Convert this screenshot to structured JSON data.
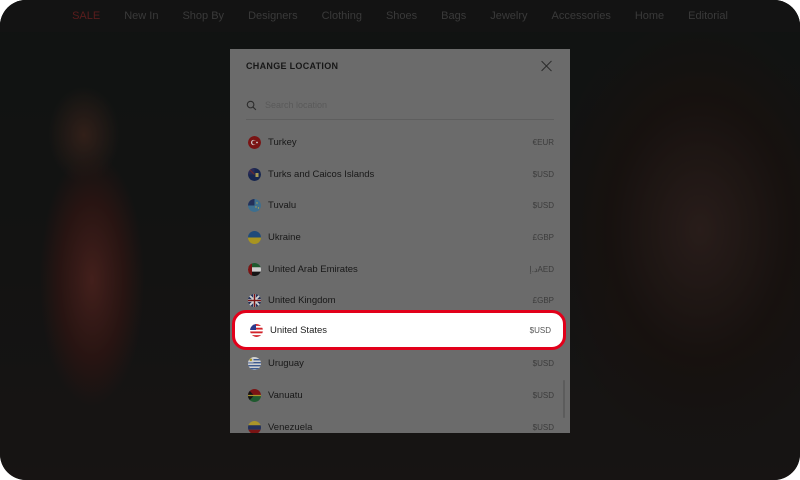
{
  "topnav": {
    "items": [
      "SALE",
      "New In",
      "Shop By",
      "Designers",
      "Clothing",
      "Shoes",
      "Bags",
      "Jewelry",
      "Accessories",
      "Home",
      "Editorial"
    ]
  },
  "modal": {
    "title": "CHANGE LOCATION",
    "search_placeholder": "Search location",
    "countries": [
      {
        "name": "Turkey",
        "currency": "€EUR"
      },
      {
        "name": "Turks and Caicos Islands",
        "currency": "$USD"
      },
      {
        "name": "Tuvalu",
        "currency": "$USD"
      },
      {
        "name": "Ukraine",
        "currency": "£GBP"
      },
      {
        "name": "United Arab Emirates",
        "currency": "د.إAED"
      },
      {
        "name": "United Kingdom",
        "currency": "£GBP"
      },
      {
        "name": "United States",
        "currency": "$USD"
      },
      {
        "name": "Uruguay",
        "currency": "$USD"
      },
      {
        "name": "Vanuatu",
        "currency": "$USD"
      },
      {
        "name": "Venezuela",
        "currency": "$USD"
      }
    ]
  },
  "colors": {
    "highlight_border": "#e2001a",
    "modal_bg_dimmed": "#6b6b6b"
  }
}
